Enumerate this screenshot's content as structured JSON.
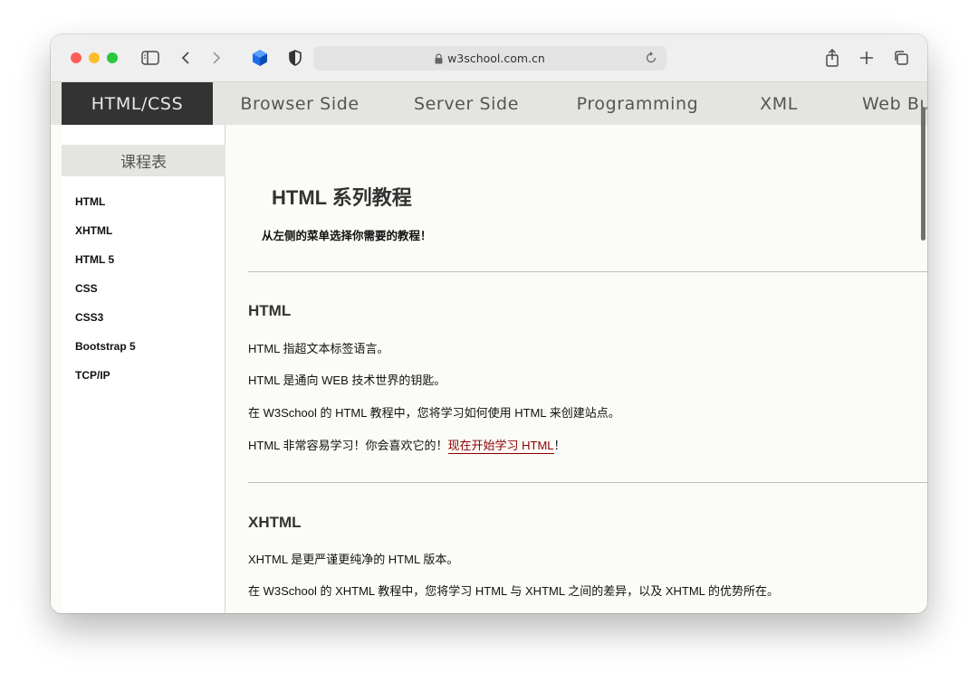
{
  "browser": {
    "address": "w3school.com.cn"
  },
  "nav": {
    "items": [
      "HTML/CSS",
      "Browser Side",
      "Server Side",
      "Programming",
      "XML",
      "Web Bu"
    ],
    "active_index": 0
  },
  "sidebar": {
    "title": "课程表",
    "links": [
      "HTML",
      "XHTML",
      "HTML 5",
      "CSS",
      "CSS3",
      "Bootstrap 5",
      "TCP/IP"
    ]
  },
  "main": {
    "title": "HTML 系列教程",
    "intro": "从左侧的菜单选择你需要的教程！",
    "sections": [
      {
        "heading": "HTML",
        "paragraphs": [
          "HTML 指超文本标签语言。",
          "HTML 是通向 WEB 技术世界的钥匙。",
          "在 W3School 的 HTML 教程中，您将学习如何使用 HTML 来创建站点。"
        ],
        "last_paragraph": {
          "text": "HTML 非常容易学习！你会喜欢它的！",
          "link": "现在开始学习 HTML",
          "suffix": "！"
        }
      },
      {
        "heading": "XHTML",
        "paragraphs": [
          "XHTML 是更严谨更纯净的 HTML 版本。",
          "在 W3School 的 XHTML 教程中，您将学习 HTML 与 XHTML 之间的差异，以及 XHTML 的优势所在。"
        ]
      }
    ]
  },
  "colors": {
    "nav_active_bg": "#333333",
    "link": "#8b0000",
    "page_bg": "#fbfbf7"
  }
}
